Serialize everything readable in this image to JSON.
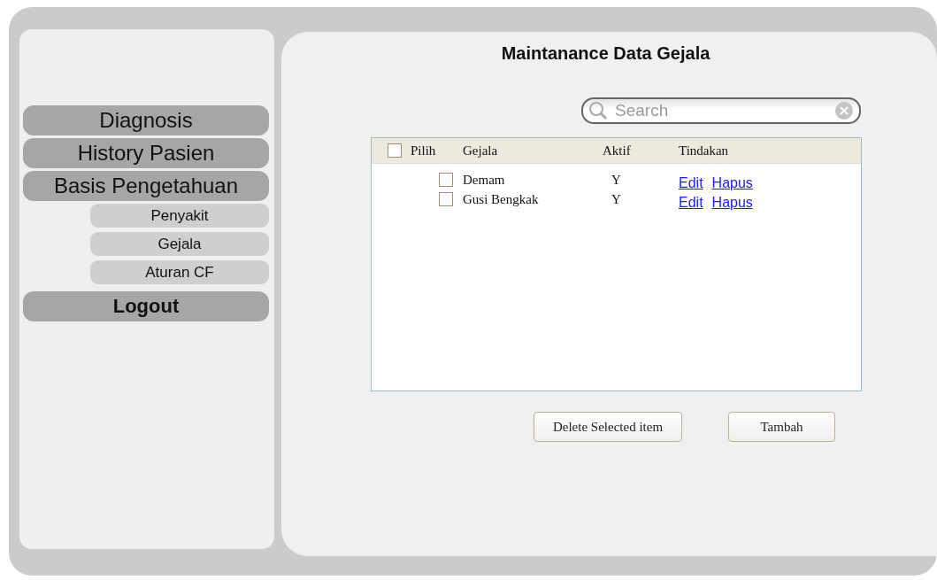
{
  "sidebar": {
    "items": [
      {
        "label": "Diagnosis",
        "kind": "main"
      },
      {
        "label": "History Pasien",
        "kind": "main"
      },
      {
        "label": "Basis Pengetahuan",
        "kind": "main"
      },
      {
        "label": "Penyakit",
        "kind": "sub"
      },
      {
        "label": "Gejala",
        "kind": "sub"
      },
      {
        "label": "Aturan CF",
        "kind": "sub"
      },
      {
        "label": "Logout",
        "kind": "action"
      }
    ]
  },
  "title": "Maintanance Data Gejala",
  "search": {
    "placeholder": "Search"
  },
  "table": {
    "select_all": {
      "checked": false
    },
    "columns": [
      "Pilih",
      "Gejala",
      "Aktif",
      "Tindakan"
    ],
    "rows": [
      {
        "checked": false,
        "gejala": "Demam",
        "aktif": "Y",
        "actions": [
          "Edit",
          "Hapus"
        ]
      },
      {
        "checked": false,
        "gejala": "Gusi Bengkak",
        "aktif": "Y",
        "actions": [
          "Edit",
          "Hapus"
        ]
      }
    ]
  },
  "buttons": [
    "Delete Selected item",
    "Tambah"
  ]
}
